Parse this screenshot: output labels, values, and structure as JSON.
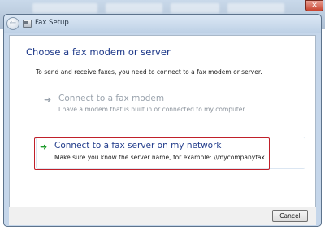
{
  "window": {
    "title": "Fax Setup",
    "close_glyph": "✕"
  },
  "wizard": {
    "heading": "Choose a fax modem or server",
    "intro": "To send and receive faxes, you need to connect to a fax modem or server.",
    "options": [
      {
        "icon": "arrow-right-icon",
        "title": "Connect to a fax modem",
        "description": "I have a modem that is built in or connected to my computer.",
        "enabled": false
      },
      {
        "icon": "arrow-right-icon",
        "title": "Connect to a fax server on my network",
        "description": "Make sure you know the server name, for example: \\\\mycompanyfax",
        "enabled": true,
        "highlighted": true
      }
    ]
  },
  "footer": {
    "cancel_label": "Cancel"
  },
  "colors": {
    "heading": "#1f3a8a",
    "highlight_border": "#c0202a",
    "arrow_active": "#1e9b2c",
    "disabled_text": "#9aa3ad"
  }
}
